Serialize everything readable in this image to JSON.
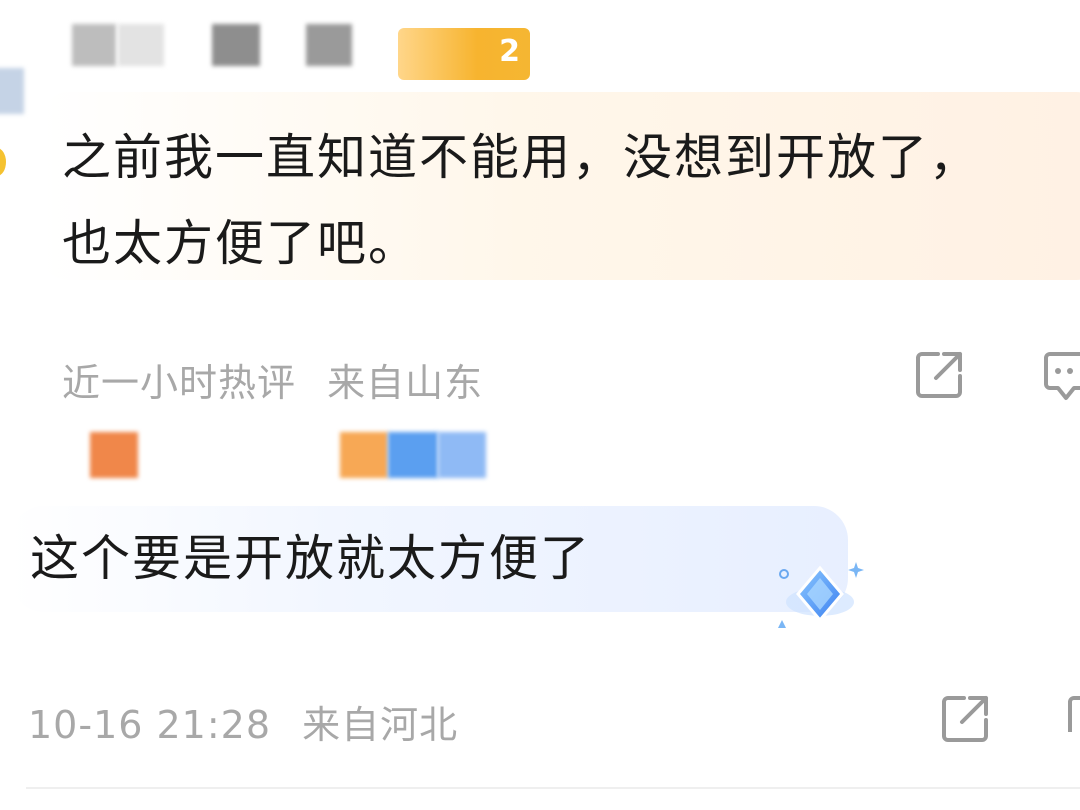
{
  "comment1": {
    "badge_text": "2",
    "body": "之前我一直知道不能用，没想到开放了，\n也太方便了吧。",
    "time": "近一小时热评",
    "location": "来自山东"
  },
  "comment2": {
    "body": "这个要是开放就太方便了",
    "time": "10-16 21:28",
    "location": "来自河北"
  },
  "icons": [
    "share-icon",
    "comment-icon",
    "diamond-sticker-icon"
  ],
  "colors": {
    "text": "#1a1a1a",
    "meta": "#a8a8a8",
    "badge": "#f5b632",
    "orange_block": "#f0874a",
    "blue_block": "#5b9ff0"
  }
}
